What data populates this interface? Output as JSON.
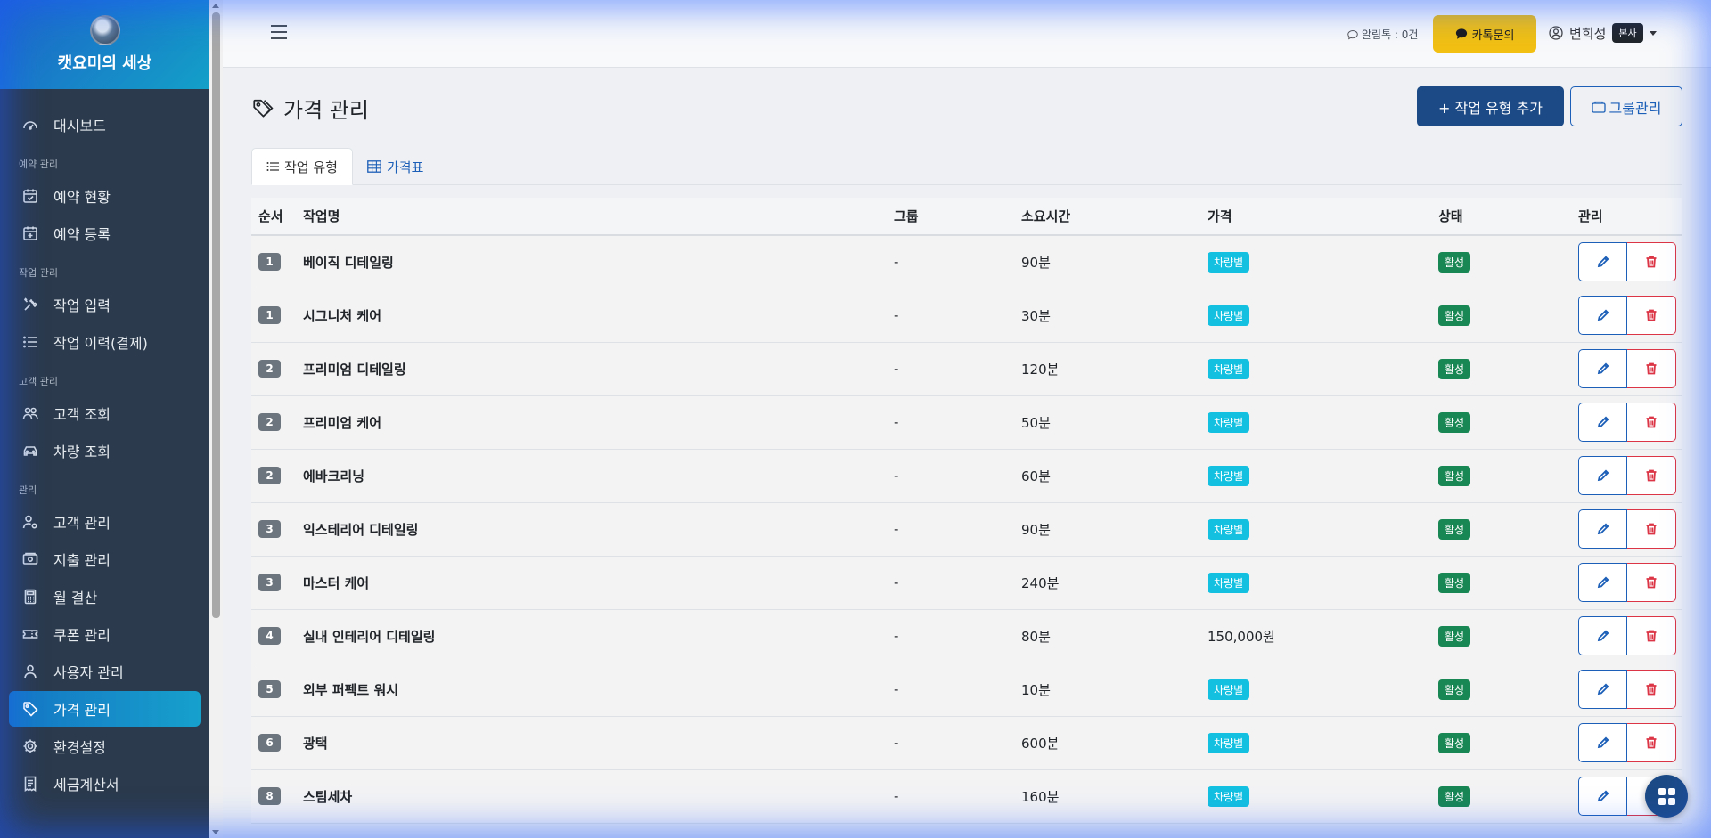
{
  "app": {
    "brand": "캣요미의 세상"
  },
  "sidebar": {
    "sections": [
      {
        "items": [
          {
            "label": "대시보드",
            "icon": "gauge-icon"
          }
        ]
      },
      {
        "title": "예약 관리",
        "items": [
          {
            "label": "예약 현황",
            "icon": "calendar-check-icon"
          },
          {
            "label": "예약 등록",
            "icon": "calendar-plus-icon"
          }
        ]
      },
      {
        "title": "작업 관리",
        "items": [
          {
            "label": "작업 입력",
            "icon": "tools-icon"
          },
          {
            "label": "작업 이력(결제)",
            "icon": "list-icon"
          }
        ]
      },
      {
        "title": "고객 관리",
        "items": [
          {
            "label": "고객 조회",
            "icon": "people-icon"
          },
          {
            "label": "차량 조회",
            "icon": "car-icon"
          }
        ]
      },
      {
        "title": "관리",
        "items": [
          {
            "label": "고객 관리",
            "icon": "user-gear-icon"
          },
          {
            "label": "지출 관리",
            "icon": "cash-icon"
          },
          {
            "label": "월 결산",
            "icon": "calculator-icon"
          },
          {
            "label": "쿠폰 관리",
            "icon": "ticket-icon"
          },
          {
            "label": "사용자 관리",
            "icon": "user-icon"
          },
          {
            "label": "가격 관리",
            "icon": "tag-icon",
            "active": true
          },
          {
            "label": "환경설정",
            "icon": "gear-icon"
          },
          {
            "label": "세금계산서",
            "icon": "receipt-icon"
          }
        ]
      }
    ]
  },
  "header": {
    "alimtalk": "알림톡 : 0건",
    "kakao_label": "카톡문의",
    "user_name": "변희성",
    "user_badge": "본사"
  },
  "page": {
    "title": "가격 관리",
    "add_button": "+ 작업 유형 추가",
    "group_button": "그룹관리",
    "tabs": [
      {
        "label": "작업 유형",
        "active": true
      },
      {
        "label": "가격표",
        "active": false
      }
    ]
  },
  "table": {
    "columns": [
      "순서",
      "작업명",
      "그룹",
      "소요시간",
      "가격",
      "상태",
      "관리"
    ],
    "rows": [
      {
        "order": "1",
        "name": "베이직 디테일링",
        "group": "-",
        "duration": "90분",
        "price": "차량별",
        "price_is_badge": true,
        "status": "활성"
      },
      {
        "order": "1",
        "name": "시그니처 케어",
        "group": "-",
        "duration": "30분",
        "price": "차량별",
        "price_is_badge": true,
        "status": "활성"
      },
      {
        "order": "2",
        "name": "프리미엄 디테일링",
        "group": "-",
        "duration": "120분",
        "price": "차량별",
        "price_is_badge": true,
        "status": "활성"
      },
      {
        "order": "2",
        "name": "프리미엄 케어",
        "group": "-",
        "duration": "50분",
        "price": "차량별",
        "price_is_badge": true,
        "status": "활성"
      },
      {
        "order": "2",
        "name": "에바크리닝",
        "group": "-",
        "duration": "60분",
        "price": "차량별",
        "price_is_badge": true,
        "status": "활성"
      },
      {
        "order": "3",
        "name": "익스테리어 디테일링",
        "group": "-",
        "duration": "90분",
        "price": "차량별",
        "price_is_badge": true,
        "status": "활성"
      },
      {
        "order": "3",
        "name": "마스터 케어",
        "group": "-",
        "duration": "240분",
        "price": "차량별",
        "price_is_badge": true,
        "status": "활성"
      },
      {
        "order": "4",
        "name": "실내 인테리어 디테일링",
        "group": "-",
        "duration": "80분",
        "price": "150,000원",
        "price_is_badge": false,
        "status": "활성"
      },
      {
        "order": "5",
        "name": "외부 퍼펙트 워시",
        "group": "-",
        "duration": "10분",
        "price": "차량별",
        "price_is_badge": true,
        "status": "활성"
      },
      {
        "order": "6",
        "name": "광택",
        "group": "-",
        "duration": "600분",
        "price": "차량별",
        "price_is_badge": true,
        "status": "활성"
      },
      {
        "order": "8",
        "name": "스팀세차",
        "group": "-",
        "duration": "160분",
        "price": "차량별",
        "price_is_badge": true,
        "status": "활성"
      }
    ]
  },
  "colors": {
    "sidebar_bg": "#2b3a4c",
    "accent": "#1c4a86",
    "info": "#13c0e0",
    "success": "#198754",
    "danger": "#dc3545",
    "kakao": "#f2c012"
  }
}
